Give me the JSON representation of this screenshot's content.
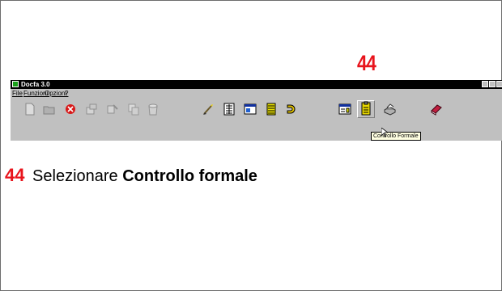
{
  "callout": {
    "number": "44"
  },
  "app": {
    "title": "Docfa 3.0",
    "menu": [
      "File",
      "Funzioni",
      "Opzioni",
      "?"
    ],
    "toolbar": {
      "icons": [
        "new-document-icon",
        "open-folder-icon",
        "close-red-icon",
        "export-icon",
        "import-icon",
        "copy-icon",
        "recycle-icon",
        "brush-icon",
        "grid-form-icon",
        "window-form-icon",
        "list-form-icon",
        "magnet-icon",
        "table-icon",
        "controllo-formale-icon",
        "printer-icon",
        "book-icon"
      ],
      "active_icon": "controllo-formale-icon"
    },
    "tooltip": "Controllo Formale"
  },
  "instruction": {
    "number": "44",
    "text": "Selezionare",
    "bold_text": "Controllo formale"
  },
  "colors": {
    "callout_red": "#e8141c",
    "window_gray": "#c0c0c0",
    "titlebar": "#000000",
    "tooltip_bg": "#ffffe1"
  }
}
